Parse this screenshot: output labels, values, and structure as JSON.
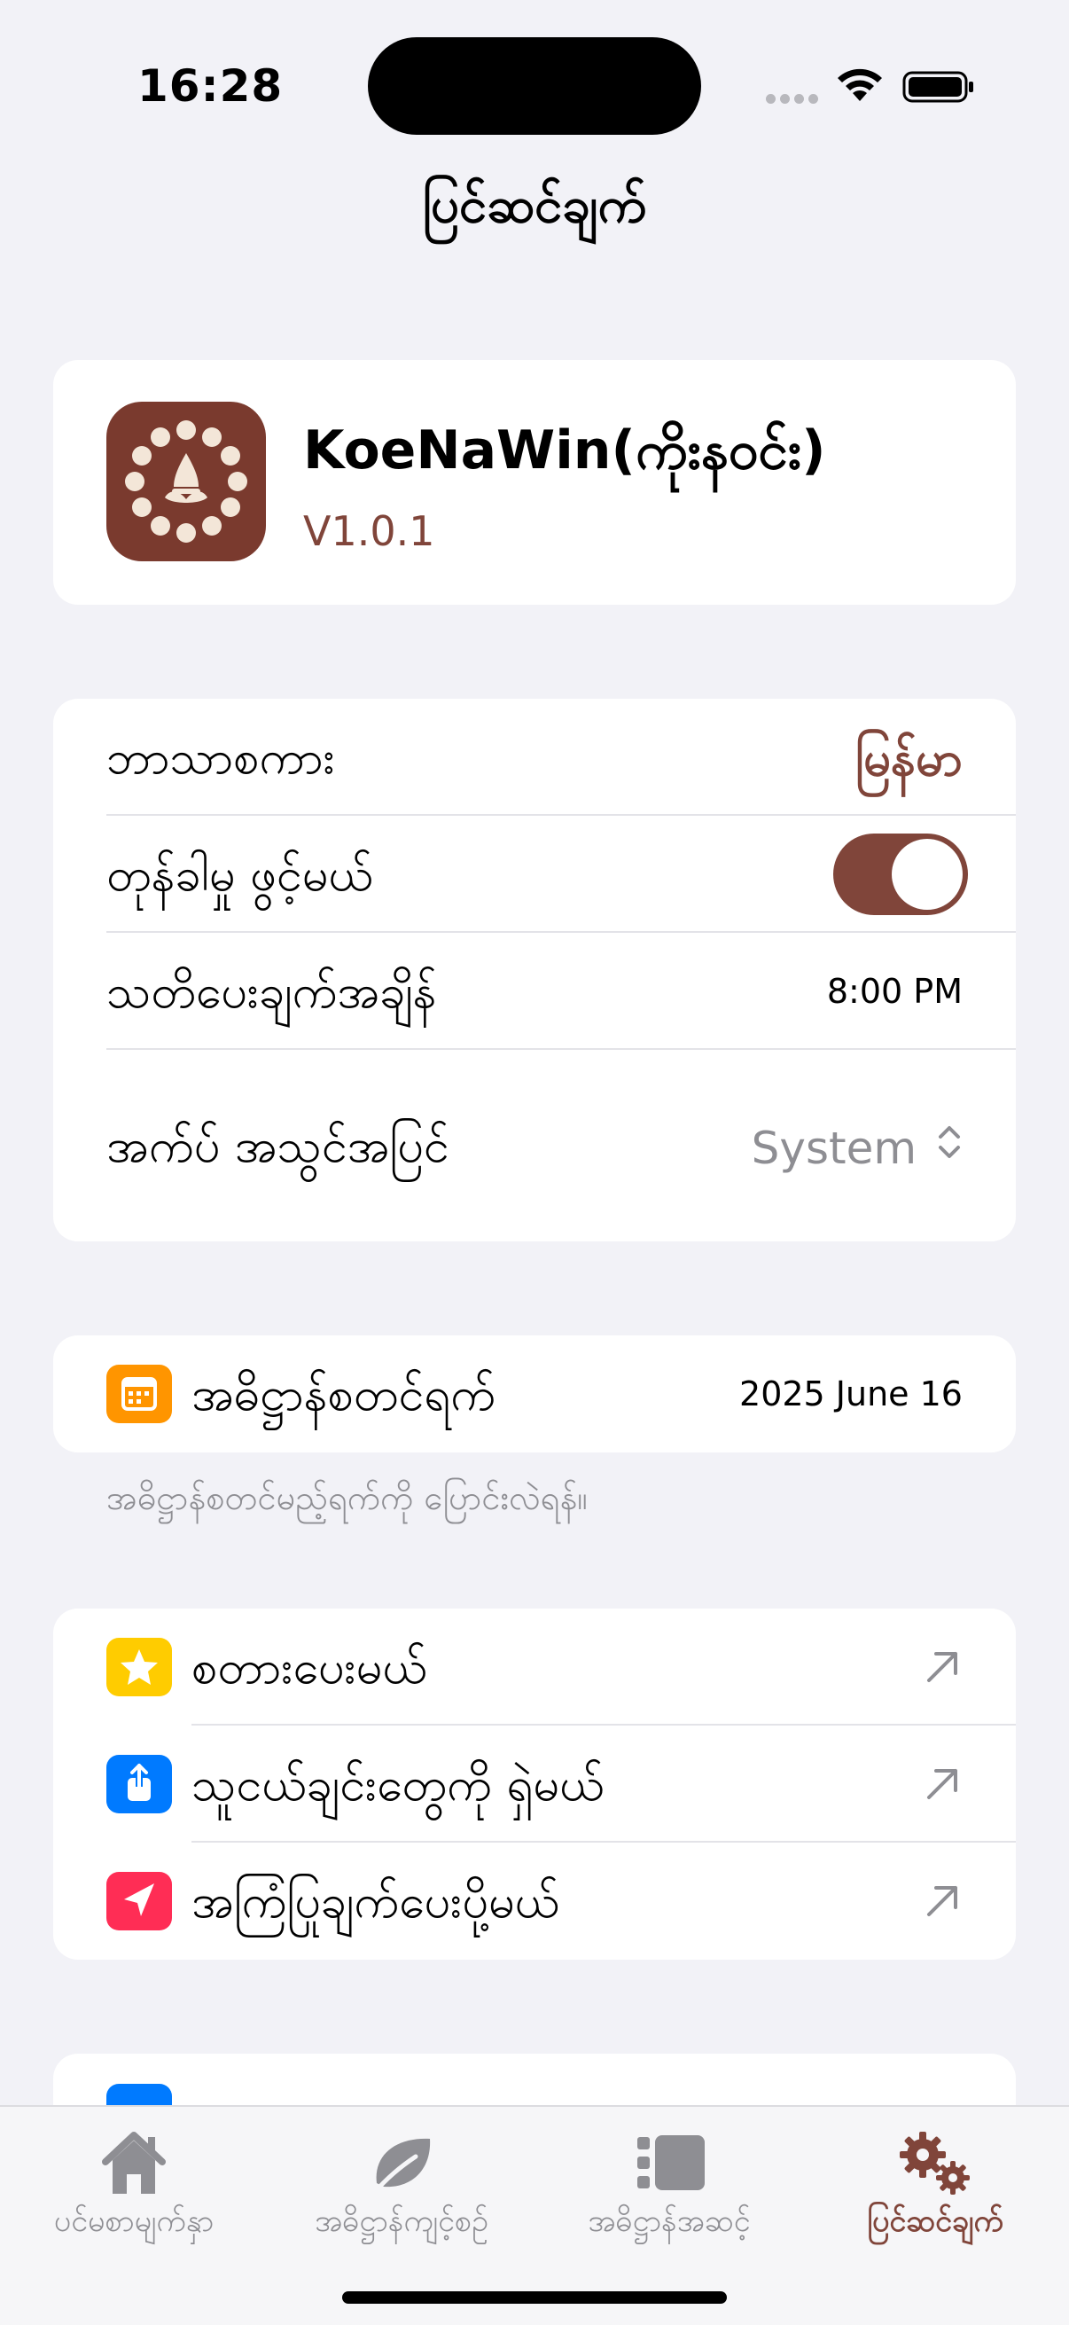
{
  "status": {
    "time": "16:28"
  },
  "nav": {
    "title": "ပြင်ဆင်ချက်"
  },
  "app": {
    "name": "KoeNaWin(ကိုးနဝင်း)",
    "version": "V1.0.1"
  },
  "settings": {
    "language": {
      "label": "ဘာသာစကား",
      "value": "မြန်မာ"
    },
    "auto_open": {
      "label": "တုန်ခါမှု ဖွင့်မယ်",
      "on": true
    },
    "reminder": {
      "label": "သတိပေးချက်အချိန်",
      "value": "8:00 PM"
    },
    "appearance": {
      "label": "အက်ပ် အသွင်အပြင်",
      "value": "System"
    }
  },
  "start_date": {
    "label": "အဓိဋ္ဌာန်စတင်ရက်",
    "value": "2025 June 16",
    "note": "အဓိဋ္ဌာန်စတင်မည့်ရက်ကို ပြောင်းလဲရန်။"
  },
  "links": [
    {
      "label": "စတားပေးမယ်",
      "icon": "star-icon",
      "color": "#ffcc00"
    },
    {
      "label": "သူငယ်ချင်းတွေကို ရှဲမယ်",
      "icon": "share-icon",
      "color": "#007aff"
    },
    {
      "label": "အကြံပြုချက်ပေးပို့မယ်",
      "icon": "send-icon",
      "color": "#ff2d55"
    }
  ],
  "tabs": [
    {
      "label": "ပင်မစာမျက်နှာ",
      "icon": "house-icon"
    },
    {
      "label": "အဓိဋ္ဌာန်ကျင့်စဉ်",
      "icon": "leaf-icon"
    },
    {
      "label": "အဓိဋ္ဌာန်အဆင့်",
      "icon": "list-icon"
    },
    {
      "label": "ပြင်ဆင်ချက်",
      "icon": "gear-icon",
      "active": true
    }
  ],
  "colors": {
    "accent": "#80453a",
    "background": "#f2f2f7",
    "card": "#ffffff",
    "secondary_text": "#8e8e93"
  }
}
